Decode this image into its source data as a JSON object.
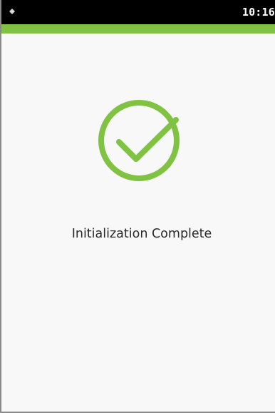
{
  "status_bar": {
    "time": "10:16",
    "left_icon": "signal-icon"
  },
  "theme": {
    "accent": "#80c242",
    "status_bar_bg": "#000000",
    "background": "#f8f8f8",
    "text": "#2a2a2a"
  },
  "screen": {
    "success_icon": "check-circle-icon",
    "message": "Initialization Complete"
  }
}
